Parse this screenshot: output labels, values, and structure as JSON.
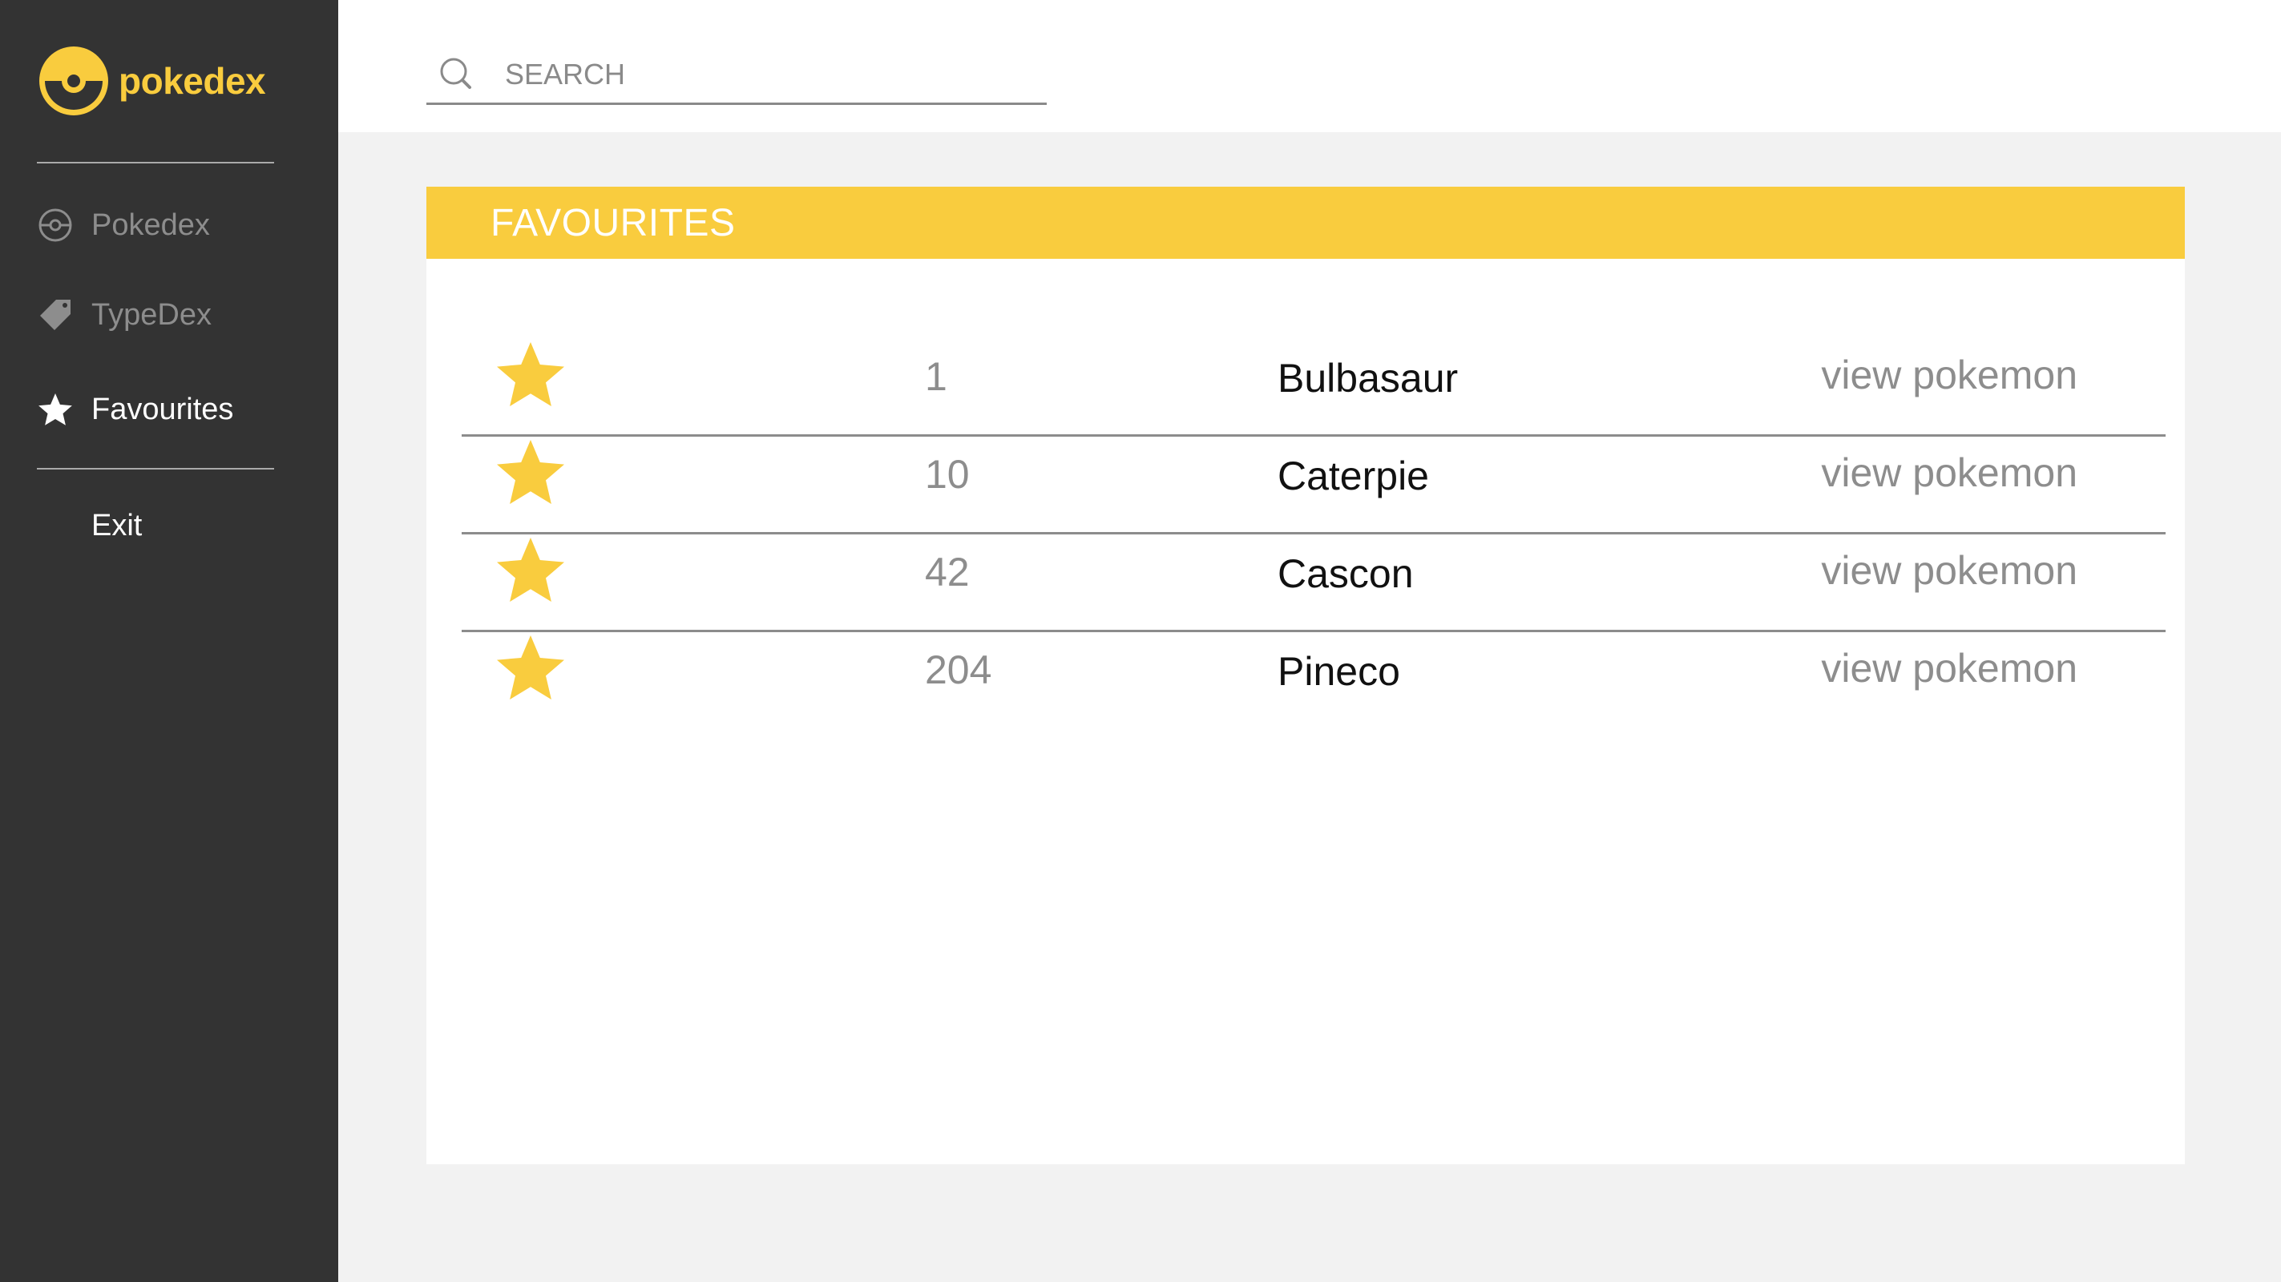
{
  "app": {
    "name": "pokedex"
  },
  "colors": {
    "accent": "#f9cc3e",
    "sidebar": "#333333",
    "background": "#f2f2f2"
  },
  "sidebar": {
    "items": [
      {
        "label": "Pokedex",
        "icon": "pokeball-icon",
        "active": false
      },
      {
        "label": "TypeDex",
        "icon": "tag-icon",
        "active": false
      },
      {
        "label": "Favourites",
        "icon": "star-icon",
        "active": true
      }
    ],
    "exit_label": "Exit"
  },
  "search": {
    "placeholder": "SEARCH",
    "value": ""
  },
  "favourites": {
    "title": "FAVOURITES",
    "rows": [
      {
        "number": "1",
        "name": "Bulbasaur",
        "action": "view pokemon"
      },
      {
        "number": "10",
        "name": "Caterpie",
        "action": "view pokemon"
      },
      {
        "number": "42",
        "name": "Cascon",
        "action": "view pokemon"
      },
      {
        "number": "204",
        "name": "Pineco",
        "action": "view pokemon"
      }
    ]
  }
}
